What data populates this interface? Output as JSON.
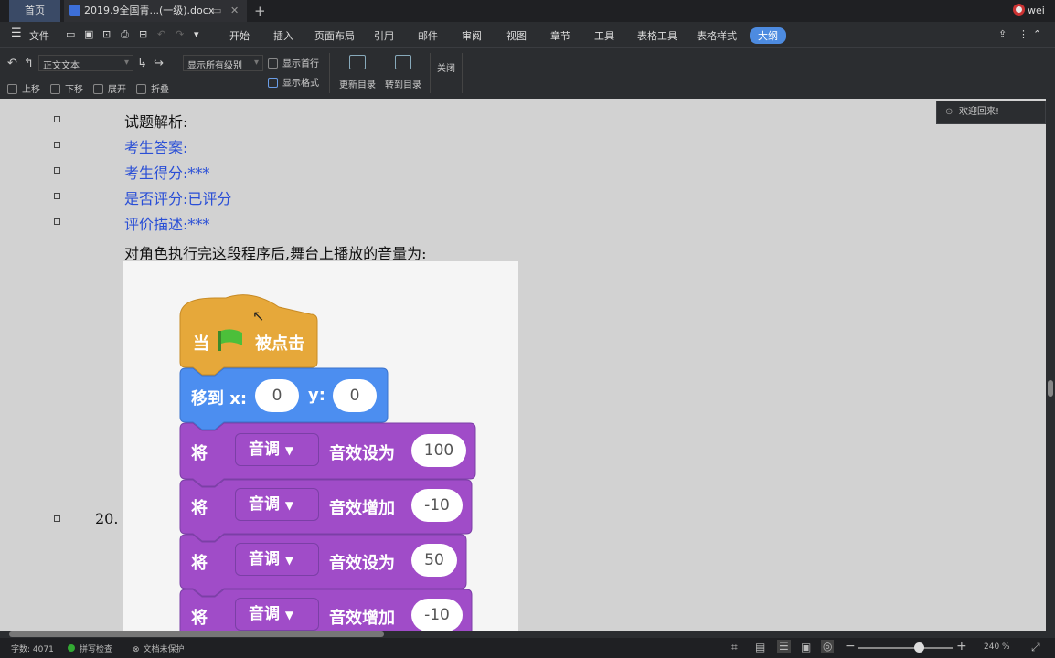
{
  "tabs": {
    "home": "首页",
    "doc": "2019.9全国青...(一级).docx",
    "user": "wei"
  },
  "menubar": {
    "file": "文件",
    "items": [
      "开始",
      "插入",
      "页面布局",
      "引用",
      "邮件",
      "审阅",
      "视图",
      "章节",
      "工具",
      "表格工具",
      "表格样式"
    ],
    "active": "大纲"
  },
  "ribbon": {
    "style_select": "正文文本",
    "level_select": "显示所有级别",
    "show_first_line": "显示首行",
    "show_format": "显示格式",
    "update_toc": "更新目录",
    "goto_toc": "转到目录",
    "close": "关闭",
    "move_up": "上移",
    "move_down": "下移",
    "expand": "展开",
    "collapse": "折叠"
  },
  "doc": {
    "lines": [
      {
        "text": "试题解析:",
        "blue": false
      },
      {
        "text": "考生答案:",
        "blue": true
      },
      {
        "text": "考生得分:***",
        "blue": true
      },
      {
        "text": "是否评分:已评分",
        "blue": true
      },
      {
        "text": "评价描述:***",
        "blue": true
      }
    ],
    "question": "对角色执行完这段程序后,舞台上播放的音量为:",
    "question_number": "20."
  },
  "welcome": "欢迎回来!",
  "scratch": {
    "hat": {
      "when": "当",
      "clicked": "被点击"
    },
    "goto": {
      "label": "移到 x:",
      "x": "0",
      "ylabel": "y:",
      "y": "0"
    },
    "sound_blocks": [
      {
        "verb": "将",
        "dropdown": "音调",
        "action": "音效设为",
        "value": "100"
      },
      {
        "verb": "将",
        "dropdown": "音调",
        "action": "音效增加",
        "value": "-10"
      },
      {
        "verb": "将",
        "dropdown": "音调",
        "action": "音效设为",
        "value": "50"
      },
      {
        "verb": "将",
        "dropdown": "音调",
        "action": "音效增加",
        "value": "-10"
      }
    ]
  },
  "status": {
    "word_count": "字数: 4071",
    "spell_check": "拼写检查",
    "protect": "文档未保护",
    "zoom": "240 %"
  },
  "colors": {
    "accent": "#4d8be0",
    "event": "#e6a83a",
    "motion": "#4c8ef0",
    "sound": "#a04cc8",
    "blue_text": "#2a4fd6"
  }
}
